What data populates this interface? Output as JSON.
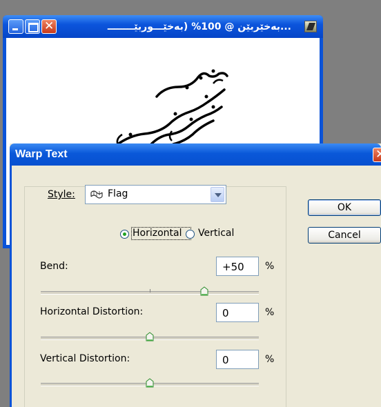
{
  "document_window": {
    "title": "...بەخێربێن @ 100% (بەخێـــوربێــــــــ",
    "canvas_text": [
      "بەخێـــربێــن",
      "بۆڤێـــربوو",
      "فەوتێــربوون"
    ]
  },
  "dialog": {
    "title": "Warp Text",
    "style": {
      "label": "Style:",
      "value": "Flag",
      "icon": "flag-warp-icon"
    },
    "orientation": {
      "horizontal_label": "Horizontal",
      "vertical_label": "Vertical",
      "selected": "Horizontal"
    },
    "bend": {
      "label": "Bend:",
      "value": "+50",
      "unit": "%",
      "slider_value": 50
    },
    "horizontal_distortion": {
      "label": "Horizontal Distortion:",
      "value": "0",
      "unit": "%",
      "slider_value": 0
    },
    "vertical_distortion": {
      "label": "Vertical Distortion:",
      "value": "0",
      "unit": "%",
      "slider_value": 0
    },
    "buttons": {
      "ok": "OK",
      "cancel": "Cancel"
    }
  }
}
